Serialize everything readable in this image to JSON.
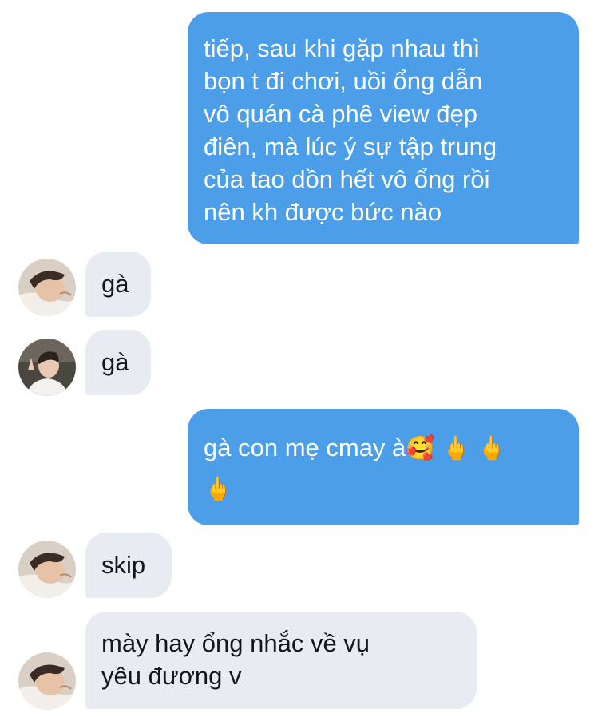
{
  "colors": {
    "sent_bubble": "#4c9ee9",
    "received_bubble": "#e6ecf1",
    "sent_text": "#ffffff",
    "received_text": "#14171a"
  },
  "messages": [
    {
      "direction": "sent",
      "lines": [
        "tiếp, sau khi gặp nhau thì",
        "bọn t đi chơi, uồi ổng dẫn",
        "vô quán cà phê view đẹp",
        "điên, mà lúc ý sự tập trung",
        "của tao dồn hết vô ổng rồi",
        "nên kh được bức nào"
      ]
    },
    {
      "direction": "received",
      "avatar": "avatar-a",
      "text": "gà"
    },
    {
      "direction": "received",
      "avatar": "avatar-b",
      "text": "gà"
    },
    {
      "direction": "sent",
      "line1_text": "gà con mẹ cmay à",
      "line1_emoji": [
        "🥰",
        "🖕",
        "🖕"
      ],
      "line2_emoji": "🖕"
    },
    {
      "direction": "received",
      "avatar": "avatar-a",
      "text": "skip"
    },
    {
      "direction": "received",
      "avatar": "avatar-a",
      "lines": [
        "mày hay ổng nhắc về vụ",
        "yêu đương v"
      ]
    }
  ]
}
